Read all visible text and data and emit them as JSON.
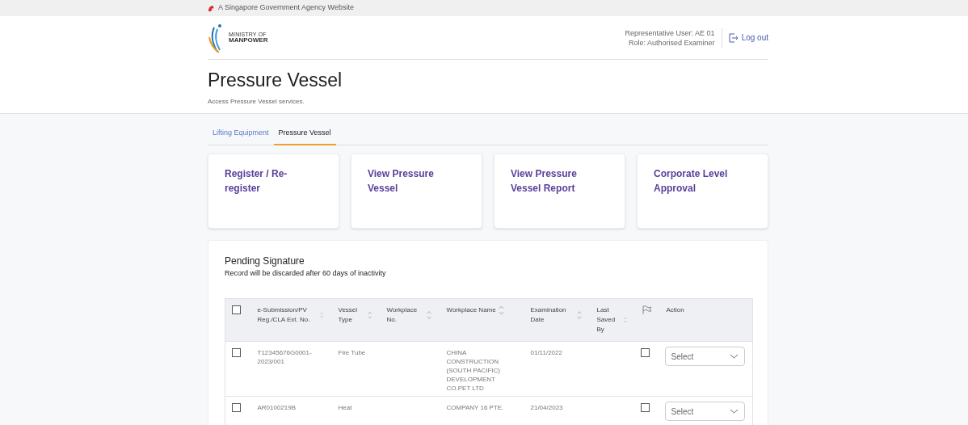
{
  "gov_banner": {
    "text": "A Singapore Government Agency Website"
  },
  "header": {
    "logo_line_1": "MINISTRY OF",
    "logo_line_2": "MANPOWER",
    "user": "Representative User: AE 01",
    "role": "Role: Authorised Examiner",
    "logout": "Log out"
  },
  "page": {
    "title": "Pressure Vessel",
    "subtitle": "Access Pressure Vessel services."
  },
  "tabs": [
    {
      "label": "Lifting Equipment",
      "selected": false
    },
    {
      "label": "Pressure Vessel",
      "selected": true
    }
  ],
  "service_cards": [
    {
      "label": "Register / Re-register"
    },
    {
      "label": "View Pressure Vessel"
    },
    {
      "label": "View Pressure Vessel Report"
    },
    {
      "label": "Corporate Level Approval"
    }
  ],
  "pending": {
    "title": "Pending Signature",
    "note": "Record will be discarded after 60 days of inactivity",
    "select_all_checked": false,
    "columns": [
      {
        "label": "e-Submission/PV Reg./CLA Ext. No.",
        "sortable": true
      },
      {
        "label": "Vessel Type",
        "sortable": true
      },
      {
        "label": "Workplace No.",
        "sortable": true
      },
      {
        "label": "Workplace Name",
        "sortable": true
      },
      {
        "label": "Examination Date",
        "sortable": true
      },
      {
        "label": "Last Saved By",
        "sortable": true
      },
      {
        "kind": "flag"
      },
      {
        "label": "Action",
        "sortable": false
      }
    ],
    "rows": [
      {
        "checked": false,
        "cells": [
          "T12345676G0001-2023/001",
          "Fire Tube",
          "",
          "CHINA CONSTRUCTION (SOUTH PACIFIC) DEVELOPMENT CO.PET LTD",
          "01/11/2022",
          ""
        ],
        "flagged": false,
        "action": "Select"
      },
      {
        "checked": false,
        "cells": [
          "AR0100219B",
          "Heat",
          "",
          "COMPANY 16 PTE.",
          "21/04/2023",
          ""
        ],
        "flagged": false,
        "action": "Select"
      }
    ]
  }
}
